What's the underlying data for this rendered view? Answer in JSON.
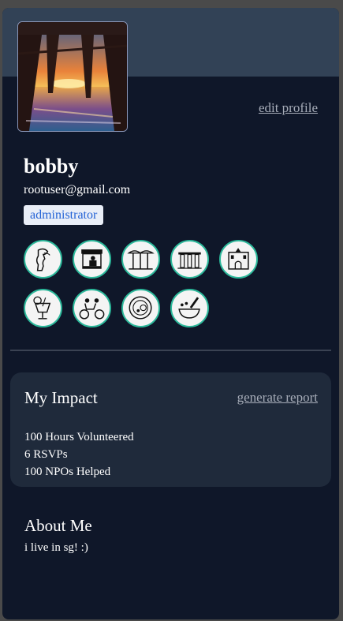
{
  "profile": {
    "name": "bobby",
    "email": "rootuser@gmail.com",
    "role": "administrator",
    "edit_label": "edit profile"
  },
  "badges": [
    {
      "icon": "merlion-icon"
    },
    {
      "icon": "hawker-stall-icon"
    },
    {
      "icon": "supertrees-icon"
    },
    {
      "icon": "marina-bay-sands-icon"
    },
    {
      "icon": "heritage-building-icon"
    },
    {
      "icon": "cocktail-icon"
    },
    {
      "icon": "trishaw-icon"
    },
    {
      "icon": "laksa-bowl-icon"
    },
    {
      "icon": "mortar-pestle-icon"
    }
  ],
  "impact": {
    "title": "My Impact",
    "report_label": "generate report",
    "stats": [
      "100 Hours Volunteered",
      "6 RSVPs",
      "100 NPOs Helped"
    ]
  },
  "about": {
    "title": "About Me",
    "text": "i live in sg! :)"
  },
  "colors": {
    "card_bg": "#0f1729",
    "banner_bg": "#324256",
    "panel_bg": "#1f2a3b",
    "badge_ring": "#2bb89a",
    "role_text": "#2463d6"
  }
}
